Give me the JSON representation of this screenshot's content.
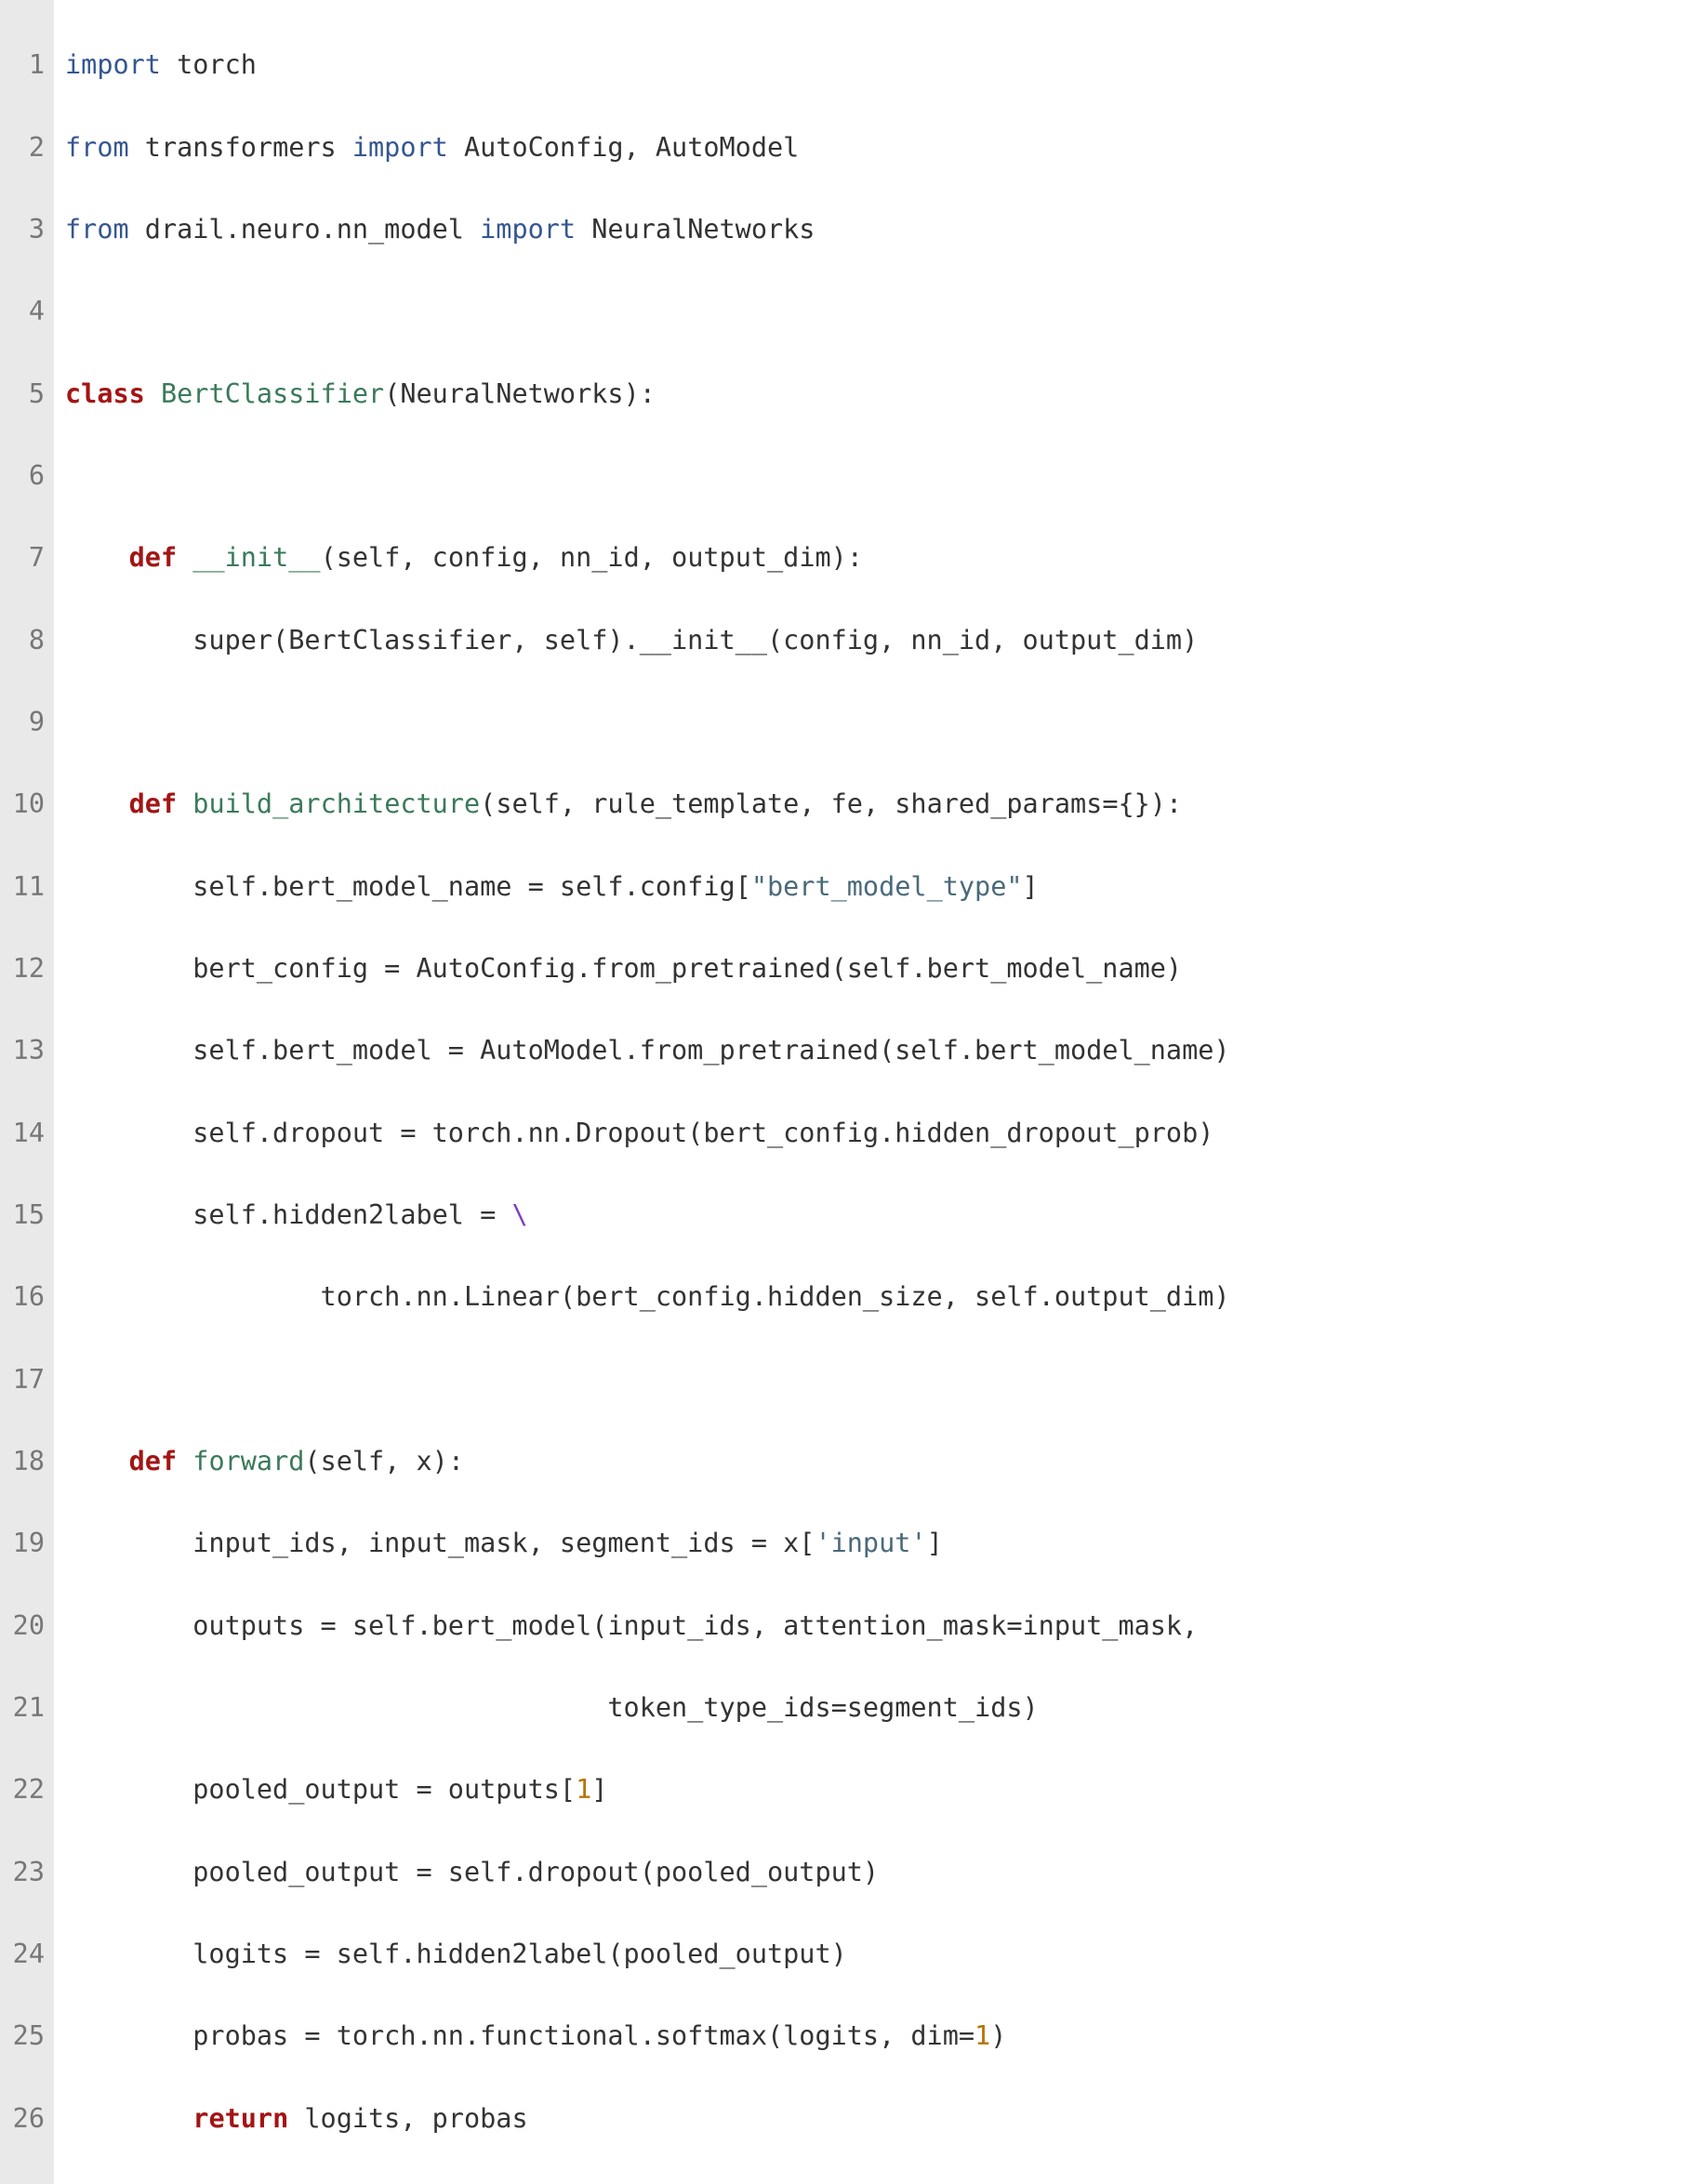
{
  "kw": {
    "import": "import",
    "from": "from",
    "class": "class",
    "def": "def",
    "return": "return"
  },
  "id": {
    "torch": "torch",
    "transformers": "transformers",
    "AutoConfig": "AutoConfig",
    "AutoModel": "AutoModel",
    "NeuralNetworks": "NeuralNetworks",
    "pkg_path": "drail.neuro.nn_model"
  },
  "cls": {
    "BertClassifier": "BertClassifier"
  },
  "fn": {
    "init": "__init__",
    "build_architecture": "build_architecture",
    "forward": "forward"
  },
  "line": {
    "l1_tail": " torch",
    "l2_tail1": " transformers ",
    "l2_tail2": " AutoConfig, AutoModel",
    "l3_tail1": " drail.neuro.nn_model ",
    "l3_tail2": " NeuralNetworks",
    "l5_open": " ",
    "l5_tail": "(NeuralNetworks):",
    "l7_pre": "    ",
    "l7_sig": "(self, config, nn_id, output_dim):",
    "l8": "        super(BertClassifier, self).__init__(config, nn_id, output_dim)",
    "l10_pre": "    ",
    "l10_sig": "(self, rule_template, fe, shared_params={}):",
    "l11_a": "        self.bert_model_name = self.config[",
    "l11_b": "]",
    "l12": "        bert_config = AutoConfig.from_pretrained(self.bert_model_name)",
    "l13": "        self.bert_model = AutoModel.from_pretrained(self.bert_model_name)",
    "l14": "        self.dropout = torch.nn.Dropout(bert_config.hidden_dropout_prob)",
    "l15_a": "        self.hidden2label = ",
    "l16": "                torch.nn.Linear(bert_config.hidden_size, self.output_dim)",
    "l18_pre": "    ",
    "l18_sig": "(self, x):",
    "l19_a": "        input_ids, input_mask, segment_ids = x[",
    "l19_b": "]",
    "l20": "        outputs = self.bert_model(input_ids, attention_mask=input_mask,",
    "l21": "                                  token_type_ids=segment_ids)",
    "l22_a": "        pooled_output = outputs[",
    "l22_b": "]",
    "l23": "        pooled_output = self.dropout(pooled_output)",
    "l24": "        logits = self.hidden2label(pooled_output)",
    "l25_a": "        probas = torch.nn.functional.softmax(logits, dim=",
    "l25_b": ")",
    "l26_pre": "        ",
    "l26_tail": " logits, probas"
  },
  "str": {
    "bert_model_type": "\"bert_model_type\"",
    "input": "'input'"
  },
  "num": {
    "one_a": "1",
    "one_b": "1",
    "one_c": "1"
  },
  "sym": {
    "backslash": "\\",
    "space": " "
  },
  "gutter": {
    "n1": "1",
    "n2": "2",
    "n3": "3",
    "n4": "4",
    "n5": "5",
    "n6": "6",
    "n7": "7",
    "n8": "8",
    "n9": "9",
    "n10": "10",
    "n11": "11",
    "n12": "12",
    "n13": "13",
    "n14": "14",
    "n15": "15",
    "n16": "16",
    "n17": "17",
    "n18": "18",
    "n19": "19",
    "n20": "20",
    "n21": "21",
    "n22": "22",
    "n23": "23",
    "n24": "24",
    "n25": "25",
    "n26": "26"
  }
}
